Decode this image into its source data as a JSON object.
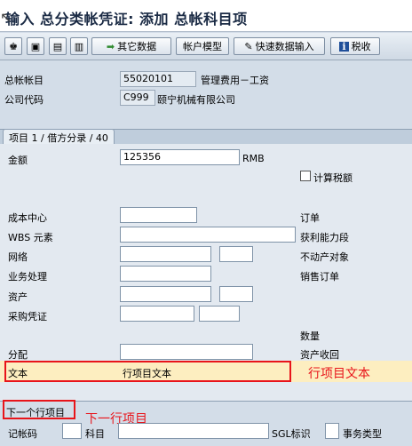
{
  "window": {
    "title": "输入 总分类帐凭证: 添加 总帐科目项"
  },
  "toolbar": {
    "buttons": [
      {
        "icon": "♚",
        "label": ""
      },
      {
        "icon": "▣",
        "label": ""
      },
      {
        "icon": "▤",
        "label": ""
      },
      {
        "icon": "▥",
        "label": ""
      },
      {
        "icon": "➡",
        "label": "其它数据"
      },
      {
        "icon": "",
        "label": "帐户模型"
      },
      {
        "icon": "✎",
        "label": "快速数据输入"
      },
      {
        "icon": "i",
        "label": "税收"
      }
    ]
  },
  "header": {
    "gl_account_label": "总帐帐目",
    "gl_account_value": "55020101",
    "gl_account_desc": "管理费用－工资",
    "company_code_label": "公司代码",
    "company_code_value": "C999",
    "company_code_desc": "颐宁机械有限公司"
  },
  "item": {
    "tab_label": "项目 1 / 借方分录 / 40",
    "amount_label": "金额",
    "amount_value": "125356",
    "currency": "RMB",
    "calc_tax_label": "计算税额",
    "cost_center_label": "成本中心",
    "wbs_label": "WBS 元素",
    "network_label": "网络",
    "business_process_label": "业务处理",
    "asset_label": "资产",
    "purchase_doc_label": "采购凭证",
    "assignment_label": "分配",
    "text_label": "文本",
    "text_value": "行项目文本",
    "sales_order_label": "订单",
    "profit_segment_label": "获利能力段",
    "real_estate_label": "不动产对象",
    "sales_doc_label": "销售订单",
    "quantity_label": "数量",
    "asset_retirement_label": "资产收回"
  },
  "annotations": {
    "text_anno": "行项目文本",
    "next_anno": "下一行项目",
    "color": "#e8141a"
  },
  "next_item": {
    "section_label": "下一个行项目",
    "posting_key_label": "记帐码",
    "account_label": "科目",
    "sgl_label": "SGL标识",
    "transaction_type_label": "事务类型"
  }
}
